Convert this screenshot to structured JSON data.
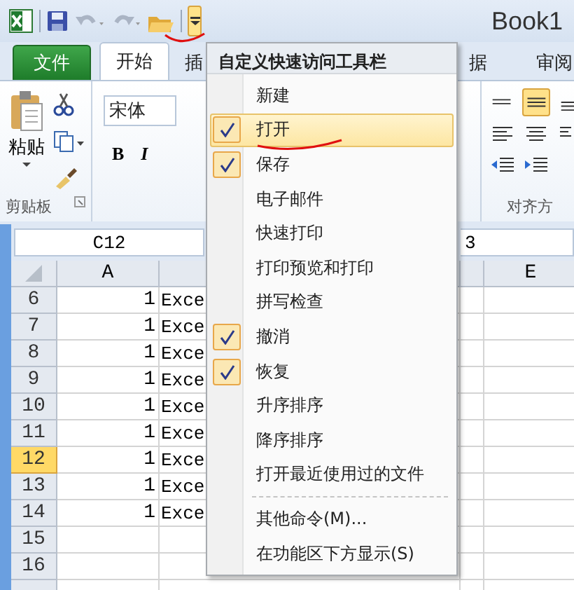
{
  "window": {
    "title": "Book1"
  },
  "quick_access": {
    "customize_expanded": true
  },
  "ribbon": {
    "tabs": [
      {
        "label": "文件",
        "kind": "file",
        "selected": false
      },
      {
        "label": "开始",
        "kind": "tab",
        "selected": true
      },
      {
        "label": "插",
        "kind": "tab",
        "selected": false
      },
      {
        "label": "据",
        "kind": "tab",
        "selected": false
      },
      {
        "label": "审阅",
        "kind": "tab",
        "selected": false
      }
    ],
    "paste_label": "粘贴",
    "clipboard_label": "剪贴板",
    "font_name": "宋体",
    "bold": "B",
    "italic": "I",
    "alignment_label": "对齐方"
  },
  "formula_bar": {
    "name_box": "C12",
    "formula": "3"
  },
  "sheet": {
    "columns": [
      {
        "label": "A"
      },
      {
        "label": "E"
      }
    ],
    "rows": [
      {
        "label": "6",
        "selected": false,
        "cells": [
          "1",
          "Exce"
        ]
      },
      {
        "label": "7",
        "selected": false,
        "cells": [
          "1",
          "Exce"
        ]
      },
      {
        "label": "8",
        "selected": false,
        "cells": [
          "1",
          "Exce"
        ]
      },
      {
        "label": "9",
        "selected": false,
        "cells": [
          "1",
          "Exce"
        ]
      },
      {
        "label": "10",
        "selected": false,
        "cells": [
          "1",
          "Exce"
        ]
      },
      {
        "label": "11",
        "selected": false,
        "cells": [
          "1",
          "Exce"
        ]
      },
      {
        "label": "12",
        "selected": true,
        "cells": [
          "1",
          "Exce"
        ]
      },
      {
        "label": "13",
        "selected": false,
        "cells": [
          "1",
          "Exce"
        ]
      },
      {
        "label": "14",
        "selected": false,
        "cells": [
          "1",
          "Exce"
        ]
      },
      {
        "label": "15",
        "selected": false,
        "cells": []
      },
      {
        "label": "16",
        "selected": false,
        "cells": []
      }
    ]
  },
  "menu": {
    "title": "自定义快速访问工具栏",
    "items": [
      {
        "label": "新建",
        "checked": false,
        "selected": false
      },
      {
        "label": "打开",
        "checked": true,
        "selected": true
      },
      {
        "label": "保存",
        "checked": true,
        "selected": false
      },
      {
        "label": "电子邮件",
        "checked": false,
        "selected": false
      },
      {
        "label": "快速打印",
        "checked": false,
        "selected": false
      },
      {
        "label": "打印预览和打印",
        "checked": false,
        "selected": false
      },
      {
        "label": "拼写检查",
        "checked": false,
        "selected": false
      },
      {
        "label": "撤消",
        "checked": true,
        "selected": false
      },
      {
        "label": "恢复",
        "checked": true,
        "selected": false
      },
      {
        "label": "升序排序",
        "checked": false,
        "selected": false
      },
      {
        "label": "降序排序",
        "checked": false,
        "selected": false
      },
      {
        "label": "打开最近使用过的文件",
        "checked": false,
        "selected": false
      }
    ],
    "commands": [
      {
        "label": "其他命令(M)..."
      },
      {
        "label": "在功能区下方显示(S)"
      }
    ]
  }
}
